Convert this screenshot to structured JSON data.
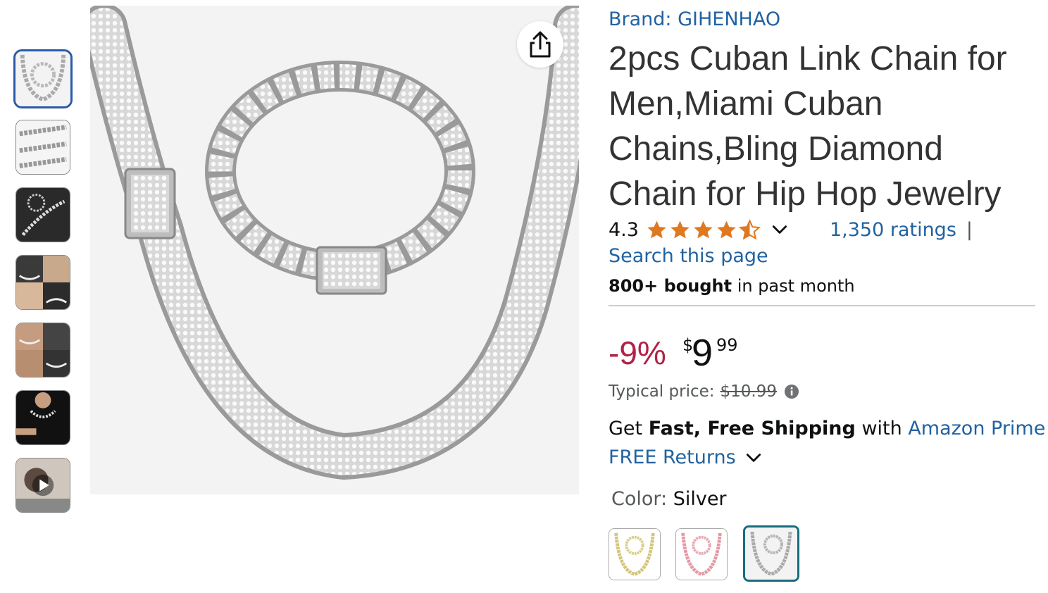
{
  "product": {
    "brand": "Brand: GIHENHAO",
    "title": "2pcs Cuban Link Chain for Men,Miami Cuban Chains,Bling Diamond Chain for Hip Hop Jewelry",
    "rating_value": "4.3",
    "rating_stars": 4.3,
    "ratings_count": "1,350 ratings",
    "separator": "|",
    "search_link": "Search this page",
    "bought_bold": "800+ bought",
    "bought_rest": " in past month"
  },
  "price": {
    "discount": "-9%",
    "currency": "$",
    "whole": "9",
    "fraction": "99",
    "typical_label": "Typical price:",
    "typical_value": "$10.99"
  },
  "shipping": {
    "prefix": "Get ",
    "bold": "Fast, Free Shipping",
    "middle": " with ",
    "link": "Amazon Prime",
    "returns": "FREE Returns"
  },
  "color": {
    "label": "Color: ",
    "value": "Silver",
    "options": [
      "Gold",
      "Rose Gold",
      "Silver"
    ],
    "selected_index": 2
  },
  "colors": {
    "link": "#2162a1",
    "discount": "#b12247",
    "star": "#de7921",
    "selected_thumb": "#2a5aa8",
    "selected_swatch": "#186d80"
  },
  "icons": {
    "share": "share-icon",
    "chevron": "chevron-down-icon",
    "info": "info-icon",
    "play": "play-icon"
  }
}
